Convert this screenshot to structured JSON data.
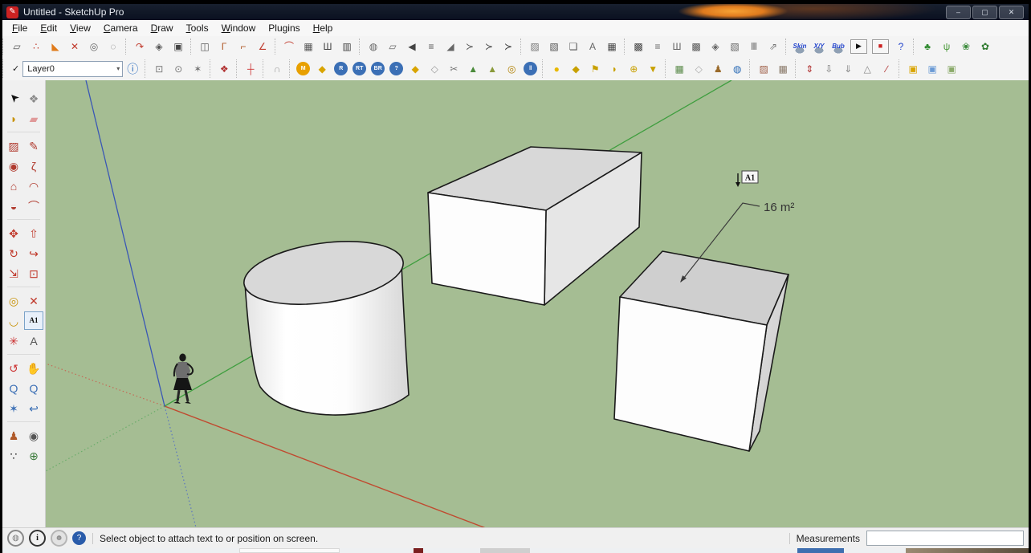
{
  "window": {
    "title": "Untitled - SketchUp Pro",
    "app_icon": {
      "glyph": "✎",
      "bg": "#cc2222"
    },
    "controls": [
      {
        "name": "minimize",
        "glyph": "–"
      },
      {
        "name": "maximize",
        "glyph": "▢"
      },
      {
        "name": "close",
        "glyph": "✕"
      }
    ]
  },
  "menu": {
    "items": [
      {
        "label": "File",
        "mnemonic": 0
      },
      {
        "label": "Edit",
        "mnemonic": 0
      },
      {
        "label": "View",
        "mnemonic": 0
      },
      {
        "label": "Camera",
        "mnemonic": 0
      },
      {
        "label": "Draw",
        "mnemonic": 0
      },
      {
        "label": "Tools",
        "mnemonic": 0
      },
      {
        "label": "Window",
        "mnemonic": 0
      },
      {
        "label": "Plugins",
        "mnemonic": -1
      },
      {
        "label": "Help",
        "mnemonic": 0
      }
    ]
  },
  "toolbar1": {
    "groups": [
      {
        "icons": [
          {
            "n": "plugin-01",
            "g": "▱",
            "c": "#555"
          },
          {
            "n": "plugin-02",
            "g": "∴",
            "c": "#c0392b"
          },
          {
            "n": "plugin-03",
            "g": "◣",
            "c": "#e07b1a"
          },
          {
            "n": "plugin-04",
            "g": "✕",
            "c": "#c0392b"
          },
          {
            "n": "plugin-05",
            "g": "◎",
            "c": "#666"
          },
          {
            "n": "plugin-06",
            "g": "◌",
            "c": "#777"
          }
        ]
      },
      {
        "icons": [
          {
            "n": "plugin-07",
            "g": "↷",
            "c": "#c0392b"
          },
          {
            "n": "plugin-08",
            "g": "◈",
            "c": "#555"
          },
          {
            "n": "plugin-09",
            "g": "▣",
            "c": "#444"
          }
        ]
      },
      {
        "icons": [
          {
            "n": "plugin-10",
            "g": "◫",
            "c": "#555"
          },
          {
            "n": "plugin-11",
            "g": "Γ",
            "c": "#b05a2a"
          },
          {
            "n": "plugin-12",
            "g": "⌐",
            "c": "#b05a2a"
          },
          {
            "n": "plugin-13",
            "g": "∠",
            "c": "#c0392b"
          }
        ]
      },
      {
        "icons": [
          {
            "n": "plugin-14",
            "g": "⌒",
            "c": "#c0392b"
          },
          {
            "n": "plugin-15",
            "g": "▦",
            "c": "#555"
          },
          {
            "n": "plugin-16",
            "g": "Ш",
            "c": "#444"
          },
          {
            "n": "plugin-17",
            "g": "▥",
            "c": "#444"
          }
        ]
      },
      {
        "icons": [
          {
            "n": "plugin-18",
            "g": "◍",
            "c": "#666"
          },
          {
            "n": "plugin-19",
            "g": "▱",
            "c": "#666"
          },
          {
            "n": "plugin-20",
            "g": "◀",
            "c": "#444"
          },
          {
            "n": "plugin-21",
            "g": "≡",
            "c": "#555"
          },
          {
            "n": "plugin-22",
            "g": "◢",
            "c": "#666"
          },
          {
            "n": "plugin-23",
            "g": "≻",
            "c": "#555"
          },
          {
            "n": "plugin-24",
            "g": "≻",
            "c": "#444"
          },
          {
            "n": "plugin-25",
            "g": "≻",
            "c": "#333"
          }
        ]
      },
      {
        "icons": [
          {
            "n": "plugin-26",
            "g": "▨",
            "c": "#777"
          },
          {
            "n": "plugin-27",
            "g": "▧",
            "c": "#555"
          },
          {
            "n": "plugin-28",
            "g": "❏",
            "c": "#555"
          },
          {
            "n": "plugin-29",
            "g": "A",
            "c": "#666"
          },
          {
            "n": "plugin-30",
            "g": "▦",
            "c": "#444"
          }
        ]
      },
      {
        "icons": [
          {
            "n": "plugin-31",
            "g": "▩",
            "c": "#444"
          },
          {
            "n": "plugin-32",
            "g": "≡",
            "c": "#666"
          },
          {
            "n": "plugin-33",
            "g": "Ш",
            "c": "#666"
          },
          {
            "n": "plugin-34",
            "g": "▩",
            "c": "#555"
          },
          {
            "n": "plugin-35",
            "g": "◈",
            "c": "#666"
          },
          {
            "n": "plugin-36",
            "g": "▧",
            "c": "#666"
          },
          {
            "n": "plugin-37",
            "g": "Ⅲ",
            "c": "#666"
          },
          {
            "n": "plugin-38",
            "g": "⇗",
            "c": "#777"
          }
        ]
      },
      {
        "icons": [
          {
            "n": "physics-skin",
            "g": "Skin",
            "cls": "phys"
          },
          {
            "n": "physics-xy",
            "g": "X/Y",
            "cls": "phys"
          },
          {
            "n": "physics-bub",
            "g": "Bub",
            "cls": "phys"
          },
          {
            "n": "physics-play",
            "g": "▶",
            "c": "#111",
            "cls": "btn"
          },
          {
            "n": "physics-stop",
            "g": "■",
            "c": "#cc2222",
            "cls": "btn"
          },
          {
            "n": "physics-help",
            "g": "?",
            "c": "#2244cc"
          }
        ]
      },
      {
        "icons": [
          {
            "n": "tree",
            "g": "♣",
            "c": "#2f8a2f"
          },
          {
            "n": "grass",
            "g": "ψ",
            "c": "#4a9a3a"
          },
          {
            "n": "leaf-swirl",
            "g": "❀",
            "c": "#3a8a3a"
          },
          {
            "n": "shrub",
            "g": "✿",
            "c": "#2f7a2f"
          }
        ]
      }
    ]
  },
  "toolbar2": {
    "layers": {
      "check": "✓",
      "value": "Layer0",
      "caret": "▾",
      "manager_glyph": "ⓘ"
    },
    "groups": [
      {
        "icons": [
          {
            "n": "shape-box",
            "g": "⊡",
            "c": "#777"
          },
          {
            "n": "shape-sphere",
            "g": "⊙",
            "c": "#777"
          },
          {
            "n": "shape-star",
            "g": "✶",
            "c": "#777"
          }
        ]
      },
      {
        "icons": [
          {
            "n": "red-bezier",
            "g": "❖",
            "c": "#b03030"
          }
        ]
      },
      {
        "icons": [
          {
            "n": "joint-pipe",
            "g": "┼",
            "c": "#cc3333"
          }
        ]
      },
      {
        "icons": [
          {
            "n": "arc-dome",
            "g": "∩",
            "c": "#999"
          }
        ]
      },
      {
        "icons": [
          {
            "n": "round-m",
            "g": "M",
            "cls": "badge",
            "bg": "#e8a000"
          },
          {
            "n": "tag-yellow",
            "g": "◆",
            "c": "#d9a400"
          },
          {
            "n": "r-badge",
            "g": "R",
            "cls": "badge",
            "bg": "#3b6fb5"
          },
          {
            "n": "rt-badge",
            "g": "RT",
            "cls": "badge",
            "bg": "#3b6fb5"
          },
          {
            "n": "br-badge",
            "g": "BR",
            "cls": "badge",
            "bg": "#3b6fb5"
          },
          {
            "n": "help-badge",
            "g": "?",
            "cls": "badge",
            "bg": "#3b6fb5"
          },
          {
            "n": "tag-e",
            "g": "◆",
            "c": "#d9a400"
          },
          {
            "n": "diamond",
            "g": "◇",
            "c": "#999"
          },
          {
            "n": "scissors",
            "g": "✂",
            "c": "#777"
          },
          {
            "n": "terrain-a",
            "g": "▲",
            "c": "#4a8a3a"
          },
          {
            "n": "terrain-b",
            "g": "▲",
            "c": "#8a9a3a"
          },
          {
            "n": "target",
            "g": "◎",
            "c": "#b08000"
          },
          {
            "n": "pause",
            "g": "‖",
            "cls": "badge",
            "bg": "#3b6fb5"
          }
        ]
      },
      {
        "icons": [
          {
            "n": "ball-joint",
            "g": "●",
            "c": "#e8b800"
          },
          {
            "n": "box-joint",
            "g": "◆",
            "c": "#c8a000"
          },
          {
            "n": "flag-joint",
            "g": "⚑",
            "c": "#c8a000"
          },
          {
            "n": "dome-joint",
            "g": "◗",
            "c": "#c8a000"
          },
          {
            "n": "sphere-joint",
            "g": "⊕",
            "c": "#c8a000"
          },
          {
            "n": "cone-joint",
            "g": "▼",
            "c": "#c8a000"
          }
        ]
      },
      {
        "icons": [
          {
            "n": "map",
            "g": "▦",
            "c": "#5a8a4a"
          },
          {
            "n": "placeholder",
            "g": "◇",
            "c": "#aaa"
          },
          {
            "n": "photo-figure",
            "g": "♟",
            "c": "#9a6a2a"
          },
          {
            "n": "google-earth",
            "g": "◍",
            "c": "#2a6ab5"
          }
        ]
      },
      {
        "icons": [
          {
            "n": "from-contours",
            "g": "▨",
            "c": "#a0614a"
          },
          {
            "n": "from-scratch",
            "g": "▦",
            "c": "#8a7a6a"
          }
        ]
      },
      {
        "icons": [
          {
            "n": "smoove",
            "g": "⇕",
            "c": "#b03030"
          },
          {
            "n": "stamp",
            "g": "⇩",
            "c": "#777"
          },
          {
            "n": "drape",
            "g": "⇓",
            "c": "#888"
          },
          {
            "n": "add-detail",
            "g": "△",
            "c": "#888"
          },
          {
            "n": "flip-edge",
            "g": "∕",
            "c": "#b03030"
          }
        ]
      },
      {
        "icons": [
          {
            "n": "solid-union",
            "g": "▣",
            "c": "#d9a400"
          },
          {
            "n": "solid-subtract",
            "g": "▣",
            "c": "#6a9ad5"
          },
          {
            "n": "solid-intersect",
            "g": "▣",
            "c": "#8aaa6a"
          }
        ]
      }
    ]
  },
  "sidebar": {
    "separators_after": [
      1,
      5,
      8,
      11,
      14
    ],
    "rows": [
      [
        {
          "n": "select",
          "g": "➤",
          "c": "#111",
          "rot": -135
        },
        {
          "n": "make-component",
          "g": "❖",
          "c": "#8a8a8a"
        }
      ],
      [
        {
          "n": "paint-bucket",
          "g": "◗",
          "c": "#c8930a"
        },
        {
          "n": "eraser",
          "g": "▰",
          "c": "#e09a9a"
        }
      ],
      [
        {
          "n": "rectangle",
          "g": "▨",
          "c": "#b03a2e"
        },
        {
          "n": "line",
          "g": "✎",
          "c": "#b03a2e"
        }
      ],
      [
        {
          "n": "circle",
          "g": "◉",
          "c": "#b03a2e"
        },
        {
          "n": "freehand",
          "g": "ζ",
          "c": "#b03a2e"
        }
      ],
      [
        {
          "n": "polygon",
          "g": "⌂",
          "c": "#b03a2e"
        },
        {
          "n": "arc-2point",
          "g": "◠",
          "c": "#b03a2e"
        }
      ],
      [
        {
          "n": "pie",
          "g": "◒",
          "c": "#b03a2e"
        },
        {
          "n": "arc",
          "g": "⌒",
          "c": "#b03a2e"
        }
      ],
      [
        {
          "n": "move",
          "g": "✥",
          "c": "#c0392b"
        },
        {
          "n": "push-pull",
          "g": "⇧",
          "c": "#c0392b"
        }
      ],
      [
        {
          "n": "rotate",
          "g": "↻",
          "c": "#c0392b"
        },
        {
          "n": "follow-me",
          "g": "↪",
          "c": "#c0392b"
        }
      ],
      [
        {
          "n": "scale",
          "g": "⇲",
          "c": "#c0392b"
        },
        {
          "n": "offset",
          "g": "⊡",
          "c": "#c0392b"
        }
      ],
      [
        {
          "n": "tape-measure",
          "g": "◎",
          "c": "#c8930a"
        },
        {
          "n": "dimension",
          "g": "✕",
          "c": "#c0392b"
        }
      ],
      [
        {
          "n": "protractor",
          "g": "◡",
          "c": "#c8930a"
        },
        {
          "n": "text",
          "g": "A1",
          "selected": true
        }
      ],
      [
        {
          "n": "axes",
          "g": "✳",
          "c": "#cc3333"
        },
        {
          "n": "3d-text",
          "g": "A",
          "c": "#555"
        }
      ],
      [
        {
          "n": "orbit",
          "g": "↺",
          "c": "#cc3333"
        },
        {
          "n": "pan",
          "g": "✋",
          "c": "#d4aa7a"
        }
      ],
      [
        {
          "n": "zoom",
          "g": "Q",
          "c": "#3b6fb5"
        },
        {
          "n": "zoom-window",
          "g": "Q",
          "c": "#3b6fb5"
        }
      ],
      [
        {
          "n": "zoom-extents",
          "g": "✶",
          "c": "#3b6fb5"
        },
        {
          "n": "zoom-previous",
          "g": "↩",
          "c": "#3b6fb5"
        }
      ],
      [
        {
          "n": "position-camera",
          "g": "♟",
          "c": "#b05a2a"
        },
        {
          "n": "look-around",
          "g": "◉",
          "c": "#555"
        }
      ],
      [
        {
          "n": "walk",
          "g": "∵",
          "c": "#111"
        },
        {
          "n": "section-plane",
          "g": "⊕",
          "c": "#3a7a3a"
        }
      ]
    ]
  },
  "canvas": {
    "area_label": "16 m²",
    "cursor_label": "A1"
  },
  "statusbar": {
    "icons": [
      {
        "n": "geolocation",
        "g": "◍",
        "fg": "#777",
        "border": "#888"
      },
      {
        "n": "credits-info",
        "g": "i",
        "fg": "#111",
        "border": "#333"
      },
      {
        "n": "user-credits",
        "g": "☻",
        "fg": "#909090",
        "bg": "#e2e2e2",
        "border": "#b5b5b5"
      },
      {
        "n": "help",
        "g": "?",
        "fg": "#ffffff",
        "bg": "#2a5caa"
      }
    ],
    "message": "Select object to attach text to or position on screen.",
    "measurements_label": "Measurements",
    "measurements_value": ""
  },
  "colors": {
    "canvas_bg": "#a5bd93",
    "axis_red": "#c04a30",
    "axis_green": "#3f9e3f",
    "axis_blue": "#3a57b5",
    "axis_red_dotted": "#c46a55",
    "axis_green_dotted": "#6aac6a",
    "axis_blue_dotted": "#5a74c0",
    "face_white": "#fdfdfd",
    "face_gray_top": "#d8d8d8",
    "face_gray_right": "#e6e6e6",
    "cube_top": "#cfcfcf",
    "cube_right": "#d9d9d9",
    "edge": "#1a1a1a",
    "leader": "#3a3a3a"
  }
}
